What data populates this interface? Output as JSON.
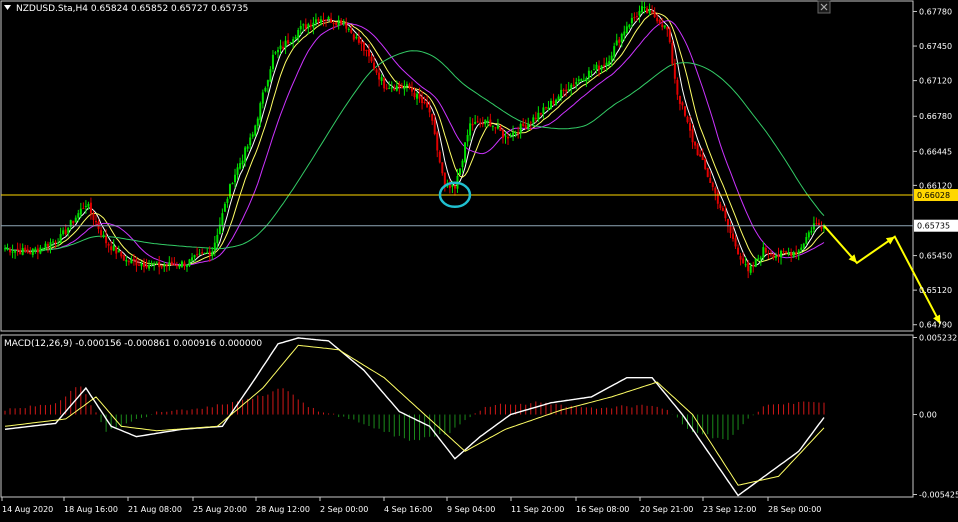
{
  "window": {
    "corner_icon": "triangle-down-icon",
    "close_icon": "close-icon"
  },
  "header": {
    "title": "NZDUSD.Sta,H4  0.65824 0.65852 0.65727 0.65735"
  },
  "macd_header": {
    "title": "MACD(12,26,9) -0.000156 -0.000861 0.000916 0.000000"
  },
  "colors": {
    "background": "#000000",
    "bull_candle": "#00e000",
    "bear_candle": "#e00000",
    "ma_fast": "#ffffff",
    "ma_mid": "#ffff66",
    "ma_slow": "#cc33ff",
    "ma_long": "#33cc66",
    "horizontal_line_yellow": "#ffd700",
    "horizontal_line_grey": "#8fa8b8",
    "circle_marker": "#20c0d0",
    "forecast_arrow": "#ffff00",
    "macd_hist_pos": "#d01818",
    "macd_hist_neg": "#1a8a1a",
    "macd_line": "#ffffff",
    "signal_line": "#ffff66"
  },
  "chart_data": [
    {
      "type": "candlestick",
      "symbol": "NZDUSD.Sta",
      "timeframe": "H4",
      "ohlc_current": {
        "open": 0.65824,
        "high": 0.65852,
        "low": 0.65727,
        "close": 0.65735
      },
      "price_axis_labels": [
        "0.67780",
        "0.67450",
        "0.67120",
        "0.66780",
        "0.66445",
        "0.66120",
        "0.65450",
        "0.65120",
        "0.64790"
      ],
      "price_tags": {
        "yellow_line": "0.66028",
        "current": "0.65735"
      },
      "time_labels": [
        "14 Aug 2020",
        "18 Aug 16:00",
        "21 Aug 08:00",
        "25 Aug 20:00",
        "28 Aug 12:00",
        "2 Sep 00:00",
        "4 Sep 16:00",
        "9 Sep 04:00",
        "11 Sep 20:00",
        "16 Sep 08:00",
        "20 Sep 21:00",
        "23 Sep 12:00",
        "28 Sep 00:00"
      ],
      "ylim": [
        0.6473,
        0.6788
      ],
      "series_waypoints": {
        "price_close": [
          [
            0,
            0.6552
          ],
          [
            10,
            0.6548
          ],
          [
            22,
            0.6562
          ],
          [
            32,
            0.6595
          ],
          [
            40,
            0.6558
          ],
          [
            48,
            0.654
          ],
          [
            62,
            0.6535
          ],
          [
            72,
            0.6538
          ],
          [
            82,
            0.655
          ],
          [
            90,
            0.6618
          ],
          [
            98,
            0.666
          ],
          [
            106,
            0.6735
          ],
          [
            116,
            0.676
          ],
          [
            124,
            0.6772
          ],
          [
            134,
            0.6768
          ],
          [
            142,
            0.6742
          ],
          [
            150,
            0.6708
          ],
          [
            160,
            0.6705
          ],
          [
            168,
            0.6682
          ],
          [
            174,
            0.661
          ],
          [
            178,
            0.6608
          ],
          [
            184,
            0.667
          ],
          [
            192,
            0.6672
          ],
          [
            198,
            0.6658
          ],
          [
            206,
            0.667
          ],
          [
            214,
            0.6685
          ],
          [
            222,
            0.6705
          ],
          [
            230,
            0.6718
          ],
          [
            238,
            0.673
          ],
          [
            246,
            0.6765
          ],
          [
            252,
            0.678
          ],
          [
            258,
            0.6772
          ],
          [
            262,
            0.676
          ],
          [
            266,
            0.67
          ],
          [
            272,
            0.6655
          ],
          [
            280,
            0.661
          ],
          [
            288,
            0.656
          ],
          [
            294,
            0.6528
          ],
          [
            300,
            0.655
          ],
          [
            306,
            0.6545
          ],
          [
            314,
            0.655
          ],
          [
            320,
            0.6575
          ],
          [
            324,
            0.65735
          ]
        ]
      },
      "moving_averages": [
        "fast",
        "mid",
        "slow",
        "long"
      ]
    },
    {
      "type": "macd",
      "params": "12,26,9",
      "values": {
        "macd": -0.000156,
        "signal": -0.000861,
        "histogram": 0.000916,
        "level": 0.0
      },
      "axis_labels": [
        "0.005232",
        "0.00",
        "-0.005425"
      ],
      "ylim": [
        -0.0056,
        0.0054
      ],
      "series_waypoints": {
        "macd_line": [
          [
            0,
            -0.001
          ],
          [
            20,
            -0.0006
          ],
          [
            32,
            0.0018
          ],
          [
            42,
            -0.0008
          ],
          [
            52,
            -0.0015
          ],
          [
            70,
            -0.001
          ],
          [
            86,
            -0.0008
          ],
          [
            98,
            0.0022
          ],
          [
            108,
            0.0048
          ],
          [
            116,
            0.0052
          ],
          [
            128,
            0.005
          ],
          [
            142,
            0.003
          ],
          [
            156,
            0.0002
          ],
          [
            168,
            -0.0008
          ],
          [
            178,
            -0.003
          ],
          [
            188,
            -0.0015
          ],
          [
            200,
            0.0
          ],
          [
            216,
            0.0008
          ],
          [
            232,
            0.0012
          ],
          [
            246,
            0.0025
          ],
          [
            256,
            0.0025
          ],
          [
            268,
            0.0
          ],
          [
            280,
            -0.003
          ],
          [
            290,
            -0.0055
          ],
          [
            302,
            -0.004
          ],
          [
            314,
            -0.0025
          ],
          [
            324,
            -0.0002
          ]
        ],
        "signal_line": [
          [
            0,
            -0.0008
          ],
          [
            24,
            -0.0003
          ],
          [
            36,
            0.0012
          ],
          [
            46,
            -0.0008
          ],
          [
            60,
            -0.0011
          ],
          [
            84,
            -0.0008
          ],
          [
            102,
            0.0018
          ],
          [
            116,
            0.0047
          ],
          [
            132,
            0.0044
          ],
          [
            150,
            0.0025
          ],
          [
            166,
            0.0
          ],
          [
            182,
            -0.0025
          ],
          [
            198,
            -0.001
          ],
          [
            220,
            0.0003
          ],
          [
            240,
            0.0012
          ],
          [
            258,
            0.0022
          ],
          [
            272,
            0.0
          ],
          [
            290,
            -0.0048
          ],
          [
            306,
            -0.0042
          ],
          [
            324,
            -0.0009
          ]
        ],
        "histogram": [
          [
            0,
            0.0003
          ],
          [
            20,
            0.0008
          ],
          [
            30,
            0.002
          ],
          [
            40,
            -0.0012
          ],
          [
            50,
            -0.0005
          ],
          [
            60,
            0.0002
          ],
          [
            80,
            0.0005
          ],
          [
            100,
            0.0012
          ],
          [
            110,
            0.0018
          ],
          [
            120,
            0.0005
          ],
          [
            140,
            -0.0005
          ],
          [
            160,
            -0.0018
          ],
          [
            176,
            -0.0012
          ],
          [
            190,
            0.0006
          ],
          [
            210,
            0.0008
          ],
          [
            230,
            0.0004
          ],
          [
            250,
            0.0006
          ],
          [
            262,
            0.0004
          ],
          [
            270,
            -0.001
          ],
          [
            285,
            -0.0018
          ],
          [
            300,
            0.0006
          ],
          [
            324,
            0.0009
          ]
        ]
      }
    }
  ]
}
